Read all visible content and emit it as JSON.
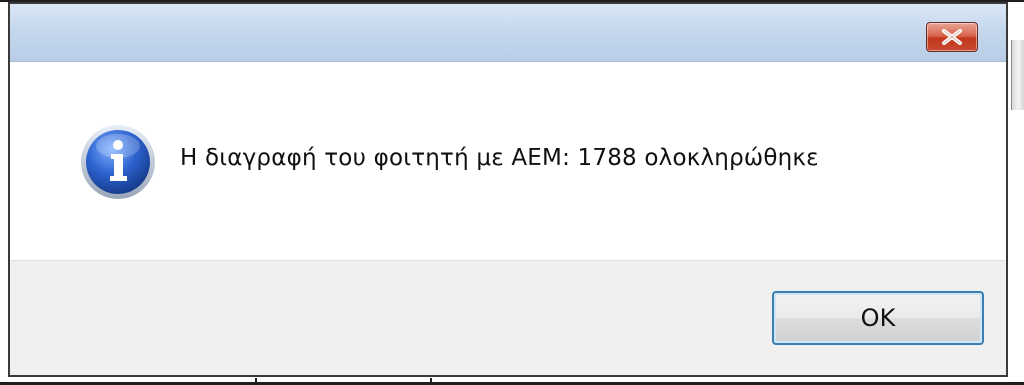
{
  "dialog": {
    "title": "",
    "message": "Η διαγραφή του φοιτητή με ΑΕΜ: 1788 ολοκληρώθηκε",
    "icon": "information-icon",
    "ok_label": "OK",
    "close_icon": "close-icon"
  },
  "colors": {
    "titlebar": "#c6d8ee",
    "close_button": "#c94a31",
    "footer": "#f0f0f0",
    "ok_border": "#3c7fb1",
    "info_icon": "#2a5cc4"
  }
}
